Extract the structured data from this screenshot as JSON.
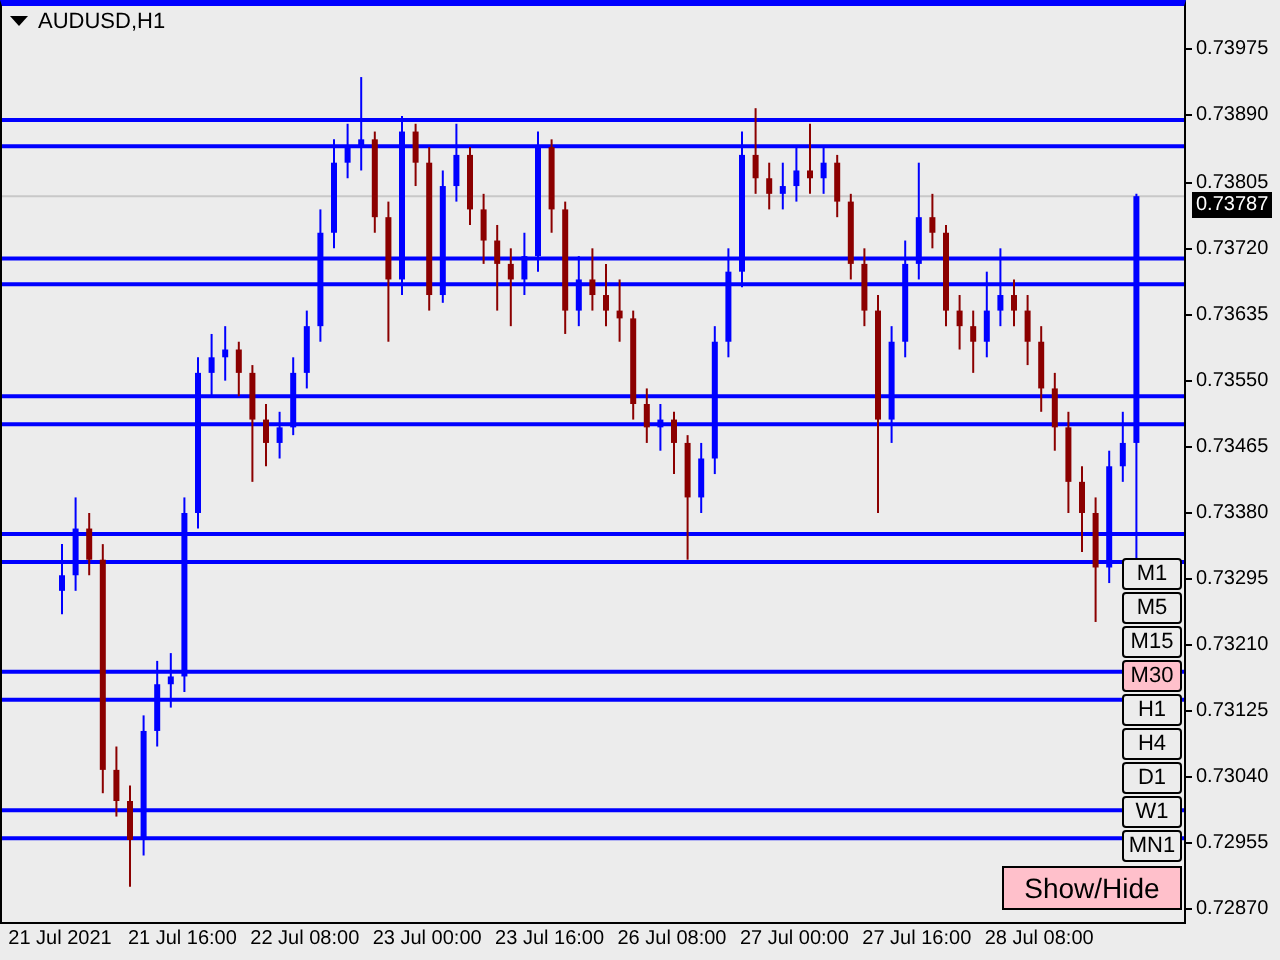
{
  "chart": {
    "title": "AUDUSD,H1",
    "chart_data": {
      "type": "candlestick",
      "categories": [
        "21 Jul 2021",
        null,
        null,
        null,
        null,
        null,
        null,
        null,
        null,
        "21 Jul 16:00",
        null,
        null,
        null,
        null,
        null,
        null,
        null,
        null,
        "22 Jul 08:00",
        null,
        null,
        null,
        null,
        null,
        null,
        null,
        null,
        "23 Jul 00:00",
        null,
        null,
        null,
        null,
        null,
        null,
        null,
        null,
        "23 Jul 16:00",
        null,
        null,
        null,
        null,
        null,
        null,
        null,
        null,
        "26 Jul 08:00",
        null,
        null,
        null,
        null,
        null,
        null,
        null,
        null,
        "27 Jul 00:00",
        null,
        null,
        null,
        null,
        null,
        null,
        null,
        null,
        "27 Jul 16:00",
        null,
        null,
        null,
        null,
        null,
        null,
        null,
        null,
        "28 Jul 08:00",
        null,
        null,
        null,
        null,
        null,
        null,
        null
      ],
      "ylim": [
        0.72852,
        0.74039
      ],
      "ref_lines": [
        {
          "axis": "y",
          "value": 0.73787,
          "label": "0.73787",
          "color": "#c8c8c8"
        },
        {
          "axis": "y",
          "value": 0.73885,
          "color": "#0000ff"
        },
        {
          "axis": "y",
          "value": 0.73851,
          "color": "#0000ff"
        },
        {
          "axis": "y",
          "value": 0.73707,
          "color": "#0000ff"
        },
        {
          "axis": "y",
          "value": 0.73674,
          "color": "#0000ff"
        },
        {
          "axis": "y",
          "value": 0.7353,
          "color": "#0000ff"
        },
        {
          "axis": "y",
          "value": 0.73494,
          "color": "#0000ff"
        },
        {
          "axis": "y",
          "value": 0.73353,
          "color": "#0000ff"
        },
        {
          "axis": "y",
          "value": 0.73317,
          "color": "#0000ff"
        },
        {
          "axis": "y",
          "value": 0.73176,
          "color": "#0000ff"
        },
        {
          "axis": "y",
          "value": 0.7314,
          "color": "#0000ff"
        },
        {
          "axis": "y",
          "value": 0.72998,
          "color": "#0000ff"
        },
        {
          "axis": "y",
          "value": 0.72962,
          "color": "#0000ff"
        }
      ],
      "ohlc": [
        [
          0.7328,
          0.7334,
          0.7325,
          0.733
        ],
        [
          0.733,
          0.734,
          0.7328,
          0.7336
        ],
        [
          0.7336,
          0.7338,
          0.733,
          0.7332
        ],
        [
          0.7332,
          0.7334,
          0.7302,
          0.7305
        ],
        [
          0.7305,
          0.7308,
          0.7299,
          0.7301
        ],
        [
          0.7301,
          0.7303,
          0.729,
          0.7296
        ],
        [
          0.7296,
          0.7312,
          0.7294,
          0.731
        ],
        [
          0.731,
          0.7319,
          0.7308,
          0.7316
        ],
        [
          0.7316,
          0.732,
          0.7313,
          0.7317
        ],
        [
          0.7317,
          0.734,
          0.7315,
          0.7338
        ],
        [
          0.7338,
          0.7358,
          0.7336,
          0.7356
        ],
        [
          0.7356,
          0.7361,
          0.7353,
          0.7358
        ],
        [
          0.7358,
          0.7362,
          0.7355,
          0.7359
        ],
        [
          0.7359,
          0.736,
          0.7353,
          0.7356
        ],
        [
          0.7356,
          0.7357,
          0.7342,
          0.735
        ],
        [
          0.735,
          0.7352,
          0.7344,
          0.7347
        ],
        [
          0.7347,
          0.7351,
          0.7345,
          0.7349
        ],
        [
          0.7349,
          0.7358,
          0.7348,
          0.7356
        ],
        [
          0.7356,
          0.7364,
          0.7354,
          0.7362
        ],
        [
          0.7362,
          0.7377,
          0.736,
          0.7374
        ],
        [
          0.7374,
          0.7386,
          0.7372,
          0.7383
        ],
        [
          0.7383,
          0.7388,
          0.7381,
          0.7385
        ],
        [
          0.7385,
          0.7394,
          0.7382,
          0.7386
        ],
        [
          0.7386,
          0.7387,
          0.7374,
          0.7376
        ],
        [
          0.7376,
          0.7378,
          0.736,
          0.7368
        ],
        [
          0.7368,
          0.7389,
          0.7366,
          0.7387
        ],
        [
          0.7387,
          0.7388,
          0.738,
          0.7383
        ],
        [
          0.7383,
          0.7385,
          0.7364,
          0.7366
        ],
        [
          0.7366,
          0.7382,
          0.7365,
          0.738
        ],
        [
          0.738,
          0.7388,
          0.7378,
          0.7384
        ],
        [
          0.7384,
          0.7385,
          0.7375,
          0.7377
        ],
        [
          0.7377,
          0.7379,
          0.737,
          0.7373
        ],
        [
          0.7373,
          0.7375,
          0.7364,
          0.737
        ],
        [
          0.737,
          0.7372,
          0.7362,
          0.7368
        ],
        [
          0.7368,
          0.7374,
          0.7366,
          0.7371
        ],
        [
          0.7371,
          0.7387,
          0.7369,
          0.7385
        ],
        [
          0.7385,
          0.7386,
          0.7374,
          0.7377
        ],
        [
          0.7377,
          0.7378,
          0.7361,
          0.7364
        ],
        [
          0.7364,
          0.7371,
          0.7362,
          0.7368
        ],
        [
          0.7368,
          0.7372,
          0.7364,
          0.7366
        ],
        [
          0.7366,
          0.737,
          0.7362,
          0.7364
        ],
        [
          0.7364,
          0.7368,
          0.736,
          0.7363
        ],
        [
          0.7363,
          0.7364,
          0.735,
          0.7352
        ],
        [
          0.7352,
          0.7354,
          0.7347,
          0.7349
        ],
        [
          0.7349,
          0.7352,
          0.7346,
          0.735
        ],
        [
          0.735,
          0.7351,
          0.7343,
          0.7347
        ],
        [
          0.7347,
          0.7348,
          0.7332,
          0.734
        ],
        [
          0.734,
          0.7347,
          0.7338,
          0.7345
        ],
        [
          0.7345,
          0.7362,
          0.7343,
          0.736
        ],
        [
          0.736,
          0.7372,
          0.7358,
          0.7369
        ],
        [
          0.7369,
          0.7387,
          0.7367,
          0.7384
        ],
        [
          0.7384,
          0.739,
          0.7379,
          0.7381
        ],
        [
          0.7381,
          0.7383,
          0.7377,
          0.7379
        ],
        [
          0.7379,
          0.7383,
          0.7377,
          0.738
        ],
        [
          0.738,
          0.7385,
          0.7378,
          0.7382
        ],
        [
          0.7382,
          0.7388,
          0.7379,
          0.7381
        ],
        [
          0.7381,
          0.7385,
          0.7379,
          0.7383
        ],
        [
          0.7383,
          0.7384,
          0.7376,
          0.7378
        ],
        [
          0.7378,
          0.7379,
          0.7368,
          0.737
        ],
        [
          0.737,
          0.7372,
          0.7362,
          0.7364
        ],
        [
          0.7364,
          0.7366,
          0.7338,
          0.735
        ],
        [
          0.735,
          0.7362,
          0.7347,
          0.736
        ],
        [
          0.736,
          0.7373,
          0.7358,
          0.737
        ],
        [
          0.737,
          0.7383,
          0.7368,
          0.7376
        ],
        [
          0.7376,
          0.7379,
          0.7372,
          0.7374
        ],
        [
          0.7374,
          0.7375,
          0.7362,
          0.7364
        ],
        [
          0.7364,
          0.7366,
          0.7359,
          0.7362
        ],
        [
          0.7362,
          0.7364,
          0.7356,
          0.736
        ],
        [
          0.736,
          0.7369,
          0.7358,
          0.7364
        ],
        [
          0.7364,
          0.7372,
          0.7362,
          0.7366
        ],
        [
          0.7366,
          0.7368,
          0.7362,
          0.7364
        ],
        [
          0.7364,
          0.7366,
          0.7357,
          0.736
        ],
        [
          0.736,
          0.7362,
          0.7351,
          0.7354
        ],
        [
          0.7354,
          0.7356,
          0.7346,
          0.7349
        ],
        [
          0.7349,
          0.7351,
          0.7338,
          0.7342
        ],
        [
          0.7342,
          0.7344,
          0.7333,
          0.7338
        ],
        [
          0.7338,
          0.734,
          0.7324,
          0.7331
        ],
        [
          0.7331,
          0.7346,
          0.7329,
          0.7344
        ],
        [
          0.7344,
          0.7351,
          0.7342,
          0.7347
        ],
        [
          0.7347,
          0.7379,
          0.7332,
          0.73787
        ]
      ],
      "yticks": [
        {
          "value": 0.73975,
          "label": "0.73975"
        },
        {
          "value": 0.7389,
          "label": "0.73890"
        },
        {
          "value": 0.73805,
          "label": "0.73805"
        },
        {
          "value": 0.7372,
          "label": "0.73720"
        },
        {
          "value": 0.73635,
          "label": "0.73635"
        },
        {
          "value": 0.7355,
          "label": "0.73550"
        },
        {
          "value": 0.73465,
          "label": "0.73465"
        },
        {
          "value": 0.7338,
          "label": "0.73380"
        },
        {
          "value": 0.73295,
          "label": "0.73295"
        },
        {
          "value": 0.7321,
          "label": "0.73210"
        },
        {
          "value": 0.73125,
          "label": "0.73125"
        },
        {
          "value": 0.7304,
          "label": "0.73040"
        },
        {
          "value": 0.72955,
          "label": "0.72955"
        },
        {
          "value": 0.7287,
          "label": "0.72870"
        }
      ]
    }
  },
  "timeframe_buttons": [
    {
      "label": "M1",
      "selected": false
    },
    {
      "label": "M5",
      "selected": false
    },
    {
      "label": "M15",
      "selected": false
    },
    {
      "label": "M30",
      "selected": true
    },
    {
      "label": "H1",
      "selected": false
    },
    {
      "label": "H4",
      "selected": false
    },
    {
      "label": "D1",
      "selected": false
    },
    {
      "label": "W1",
      "selected": false
    },
    {
      "label": "MN1",
      "selected": false
    }
  ],
  "show_hide_button": {
    "label": "Show/Hide"
  }
}
